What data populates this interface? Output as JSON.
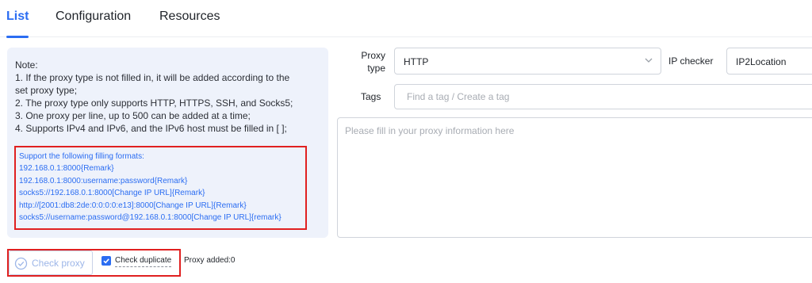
{
  "tabs": [
    {
      "label": "List",
      "active": true
    },
    {
      "label": "Configuration",
      "active": false
    },
    {
      "label": "Resources",
      "active": false
    }
  ],
  "note": {
    "title": "Note:",
    "line1a": "1. If the proxy type is not filled in, it will be added according to the",
    "line1b": "set proxy type;",
    "line2": "2. The proxy type only supports HTTP, HTTPS, SSH, and Socks5;",
    "line3": "3. One proxy per line, up to 500 can be added at a time;",
    "line4": "4. Supports IPv4 and IPv6, and the IPv6 host must be filled in [ ];",
    "formats_title": "Support the following filling formats:",
    "formats": [
      "192.168.0.1:8000{Remark}",
      "192.168.0.1:8000:username:password{Remark}",
      "socks5://192.168.0.1:8000[Change IP URL]{Remark}",
      "http://[2001:db8:2de:0:0:0:0:e13]:8000[Change IP URL]{Remark}",
      "socks5://username:password@192.168.0.1:8000[Change IP URL]{remark}"
    ]
  },
  "form": {
    "proxy_type_label_1": "Proxy",
    "proxy_type_label_2": "type",
    "proxy_type_value": "HTTP",
    "ip_checker_label": "IP checker",
    "ip_checker_value": "IP2Location",
    "tags_label": "Tags",
    "tags_placeholder": "Find a tag / Create a tag",
    "proxy_info_placeholder": "Please fill in your proxy information here"
  },
  "footer": {
    "check_proxy_label": "Check proxy",
    "check_duplicate_label": "Check duplicate",
    "check_duplicate_checked": true,
    "proxy_added": "Proxy added:0"
  },
  "colors": {
    "accent": "#2b6df2",
    "highlight_border": "#e02020",
    "note_background": "#eef2fb"
  }
}
